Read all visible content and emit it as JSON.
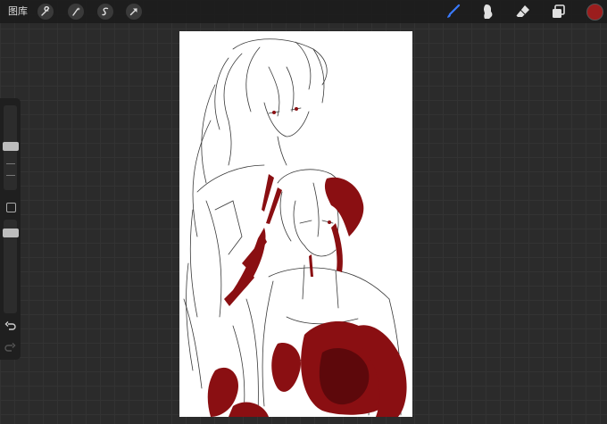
{
  "topbar": {
    "gallery_label": "图库",
    "actions": [
      {
        "name": "wrench-icon"
      },
      {
        "name": "magic-wand-icon"
      },
      {
        "name": "selection-icon"
      },
      {
        "name": "transform-arrow-icon"
      }
    ],
    "tools": [
      {
        "name": "brush-icon",
        "active": true
      },
      {
        "name": "smudge-icon",
        "active": false
      },
      {
        "name": "eraser-icon",
        "active": false
      },
      {
        "name": "layers-icon",
        "active": false
      }
    ],
    "current_color": "#9b1d1d"
  },
  "sidebar": {
    "brush_size_level": 0.2,
    "opacity_level": 0.15,
    "undo_icon": "undo-icon",
    "redo_icon": "redo-icon"
  },
  "colors": {
    "active_tool": "#3a7bff",
    "blood": "#8a0f12",
    "sketch_line": "#3a3a3a"
  }
}
